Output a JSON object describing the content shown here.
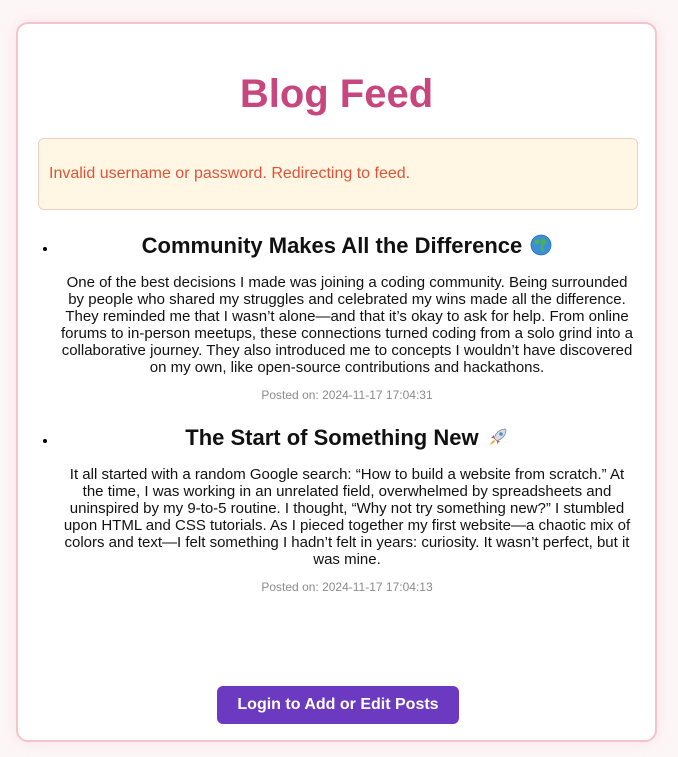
{
  "header": {
    "title": "Blog Feed"
  },
  "alert": {
    "message": "Invalid username or password. Redirecting to feed."
  },
  "posts": [
    {
      "title": "Community Makes All the Difference",
      "icon": "globe-icon",
      "body": "One of the best decisions I made was joining a coding community. Being surrounded by people who shared my struggles and celebrated my wins made all the difference. They reminded me that I wasn’t alone—and that it’s okay to ask for help. From online forums to in-person meetups, these connections turned coding from a solo grind into a collaborative journey. They also introduced me to concepts I wouldn’t have discovered on my own, like open-source contributions and hackathons.",
      "posted": "Posted on: 2024-11-17 17:04:31"
    },
    {
      "title": "The Start of Something New",
      "icon": "rocket-icon",
      "body": "It all started with a random Google search: “How to build a website from scratch.” At the time, I was working in an unrelated field, overwhelmed by spreadsheets and uninspired by my 9-to-5 routine. I thought, “Why not try something new?” I stumbled upon HTML and CSS tutorials. As I pieced together my first website—a chaotic mix of colors and text—I felt something I hadn’t felt in years: curiosity. It wasn’t perfect, but it was mine.",
      "posted": "Posted on: 2024-11-17 17:04:13"
    }
  ],
  "actions": {
    "login_label": "Login to Add or Edit Posts"
  },
  "colors": {
    "title": "#c8467e",
    "alert_text": "#e0533a",
    "alert_bg": "#fff7e3",
    "button_bg": "#6c3ac1"
  }
}
